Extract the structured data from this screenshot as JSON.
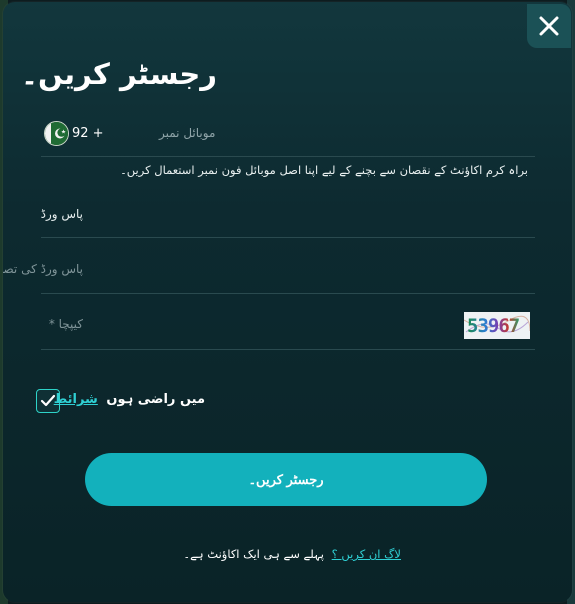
{
  "modal": {
    "title": "رجسٹر کریں۔"
  },
  "phone": {
    "label": "موبائل نمبر",
    "prefix": "92 +",
    "helper": "براہ کرم اکاؤنٹ کے نقصان سے بچنے کے لیے اپنا اصل موبائل فون نمبر استعمال کریں۔"
  },
  "password": {
    "value": "پاس ورڈ"
  },
  "confirm_password": {
    "placeholder": "پاس ورڈ کی تصدیق کریں"
  },
  "captcha": {
    "placeholder": "کیپچا *",
    "code": "53967"
  },
  "terms": {
    "checked": true,
    "text": "میں راضی ہوں",
    "link": "شرائط"
  },
  "register_button": {
    "label": "رجسٹر کریں۔"
  },
  "login": {
    "text": "پہلے سے ہی ایک اکاؤنٹ ہے۔",
    "link": "لاگ ان کریں ؟"
  },
  "colors": {
    "accent": "#13b1bc",
    "link": "#2fd0d4",
    "modal_bg": "#0d2a30"
  },
  "icons": {
    "close": "close-icon",
    "checkbox": "checkmark-icon",
    "flag": "pakistan-flag-icon"
  }
}
